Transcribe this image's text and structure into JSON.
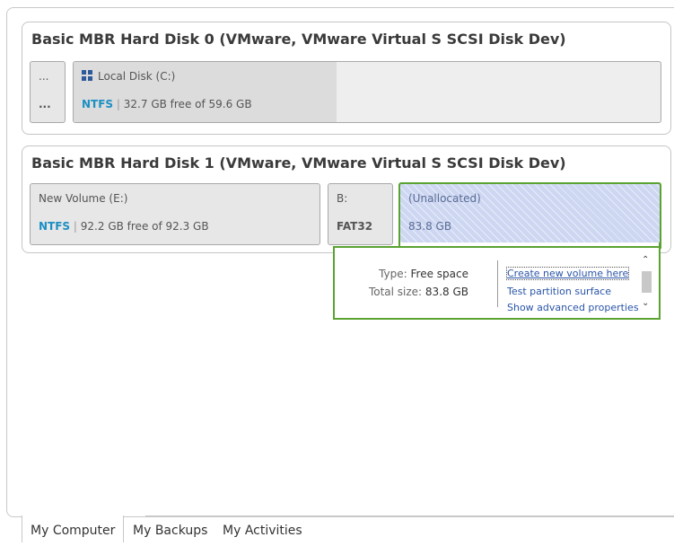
{
  "disks": [
    {
      "title": "Basic MBR Hard Disk 0 (VMware, VMware Virtual S SCSI Disk Dev)",
      "partitions": [
        {
          "name": "...",
          "info": "..."
        },
        {
          "name": "Local Disk (C:)",
          "fs": "NTFS",
          "info": "32.7 GB free of 59.6 GB",
          "icon": "windows-icon"
        }
      ]
    },
    {
      "title": "Basic MBR Hard Disk 1 (VMware, VMware Virtual S SCSI Disk Dev)",
      "partitions": [
        {
          "name": "New Volume (E:)",
          "fs": "NTFS",
          "info": "92.2 GB free of 92.3 GB"
        },
        {
          "name": "B:",
          "fs": "FAT32"
        },
        {
          "name": "(Unallocated)",
          "info": "83.8 GB"
        }
      ]
    }
  ],
  "details": {
    "type_label": "Type:",
    "type_value": "Free space",
    "size_label": "Total size:",
    "size_value": "83.8 GB",
    "actions": [
      "Create new volume here",
      "Test partition surface",
      "Show advanced properties"
    ]
  },
  "separator": "|",
  "scroll": {
    "up": "⌃",
    "down": "⌄"
  },
  "tabs": [
    "My Computer",
    "My Backups",
    "My Activities"
  ],
  "colors": {
    "accent_green": "#5aa332",
    "ntfs": "#1c8fc4",
    "fat32": "#c08a22",
    "link": "#2a55a8"
  }
}
